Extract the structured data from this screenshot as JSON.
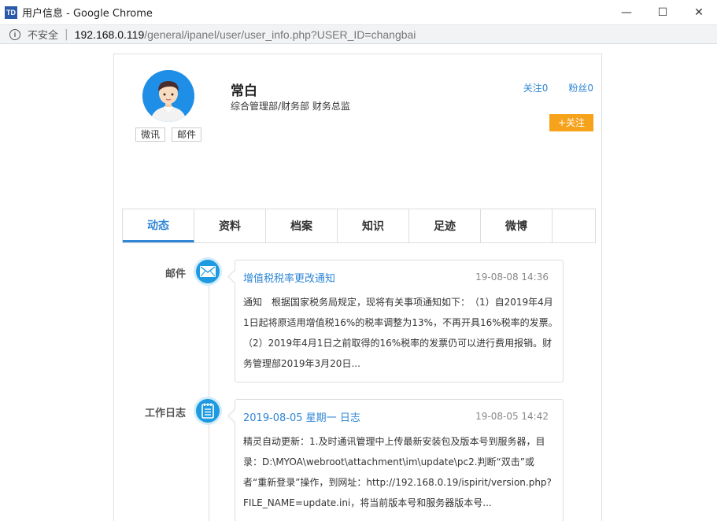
{
  "window": {
    "title": "用户信息 - Google Chrome",
    "app_icon_text": "TD",
    "minimize": "—",
    "maximize": "☐",
    "close": "✕"
  },
  "address": {
    "security_label": "不安全",
    "separator": "|",
    "host": "192.168.0.119",
    "path": "/general/ipanel/user/user_info.php?USER_ID=changbai"
  },
  "profile": {
    "name": "常白",
    "dept": "综合管理部/财务部 财务总监",
    "weixun_label": "微讯",
    "email_label": "邮件",
    "following": "关注0",
    "followers": "粉丝0",
    "follow_button": "+关注"
  },
  "tabs": [
    {
      "label": "动态"
    },
    {
      "label": "资料"
    },
    {
      "label": "档案"
    },
    {
      "label": "知识"
    },
    {
      "label": "足迹"
    },
    {
      "label": "微博"
    }
  ],
  "timeline": [
    {
      "label": "邮件",
      "icon": "mail-icon",
      "title": "增值税税率更改通知",
      "time": "19-08-08 14:36",
      "body": "通知　根据国家税务局规定，现将有关事项通知如下：　（1）自2019年4月1日起将原适用增值税16%的税率调整为13%，不再开具16%税率的发票。　（2）2019年4月1日之前取得的16%税率的发票仍可以进行费用报销。财务管理部2019年3月20日..."
    },
    {
      "label": "工作日志",
      "icon": "notepad-icon",
      "title": "2019-08-05 星期一 日志",
      "time": "19-08-05 14:42",
      "body": "精灵自动更新：1.及时通讯管理中上传最新安装包及版本号到服务器，目录：D:\\MYOA\\webroot\\attachment\\im\\update\\pc2.判断“双击”或者“重新登录”操作，到网址：http://192.168.0.19/ispirit/version.php?FILE_NAME=update.ini，将当前版本号和服务器版本号..."
    }
  ],
  "colors": {
    "accent": "#2f86d6",
    "follow": "#f7a21b",
    "icon_blue": "#1e9ae0"
  }
}
